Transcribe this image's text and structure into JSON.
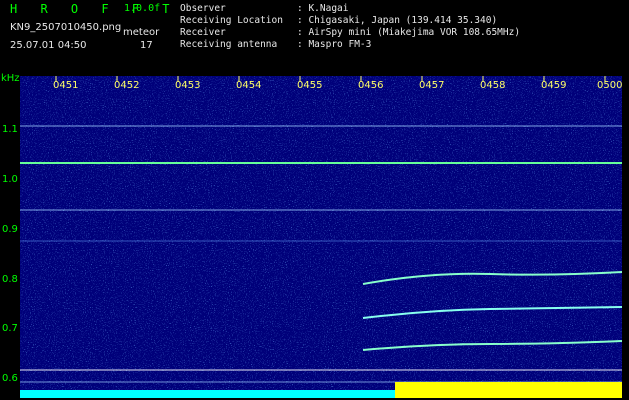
{
  "header": {
    "brand": "H R O F F T",
    "version": "1.0.0f",
    "filename": "KN9_2507010450.png",
    "meteor_label": "meteor",
    "meteor_count": "17",
    "timestamp": "25.07.01 04:50",
    "info": [
      {
        "label": "Observer",
        "value": ": K.Nagai"
      },
      {
        "label": "Receiving Location",
        "value": ": Chigasaki, Japan (139.414 35.340)"
      },
      {
        "label": "Receiver",
        "value": ": AirSpy mini (Miakejima VOR 108.65MHz)"
      },
      {
        "label": "Receiving antenna",
        "value": ": Maspro FM-3"
      }
    ]
  },
  "axis": {
    "y_unit": "kHz",
    "y_ticks": [
      "1.1",
      "1.0",
      "0.9",
      "0.8",
      "0.7",
      "0.6"
    ],
    "x_ticks": [
      "0451",
      "0452",
      "0453",
      "0454",
      "0455",
      "0456",
      "0457",
      "0458",
      "0459",
      "0500"
    ]
  },
  "colors": {
    "background": "#00007a",
    "text_green": "#00ff00",
    "tick_yellow": "#ffff66",
    "signal_cyan": "#00ffff",
    "signal_yellow": "#ffff00"
  }
}
